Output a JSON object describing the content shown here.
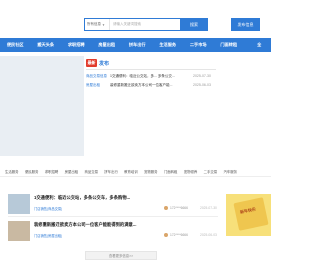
{
  "search": {
    "select_label": "所有信息",
    "placeholder": "请输入关键词搜索",
    "button_label": "搜索",
    "publish_label": "发布信息"
  },
  "nav": {
    "items": [
      "便民社区",
      "搬天头条",
      "求职招聘",
      "房屋出租",
      "拼车出行",
      "生活服务",
      "二手市场",
      "门面转租",
      "全"
    ]
  },
  "notice": {
    "badge": "最新",
    "title": "发布",
    "rows": [
      {
        "tag": "商品交易信息",
        "text": "1交通便利：临近公交站，多... 多条公交...",
        "date": "2025-07-30"
      },
      {
        "tag": "房屋出租",
        "text": "装修重新搬迁欲卖方本公司一位客户能...",
        "date": "2025-06-03"
      }
    ]
  },
  "categories": [
    "生活服务",
    "便民服务",
    "求职招聘",
    "房屋出租",
    "商品交易",
    "拼车出行",
    "教育培训",
    "宠物服务",
    "门面转租",
    "宠物领养",
    "二手交易",
    "汽车服务"
  ],
  "listings": [
    {
      "title": "1交通便利：临近公交站，多条公交车，多条购物...",
      "category": "门店销售|商品交易|",
      "user": "172****6666",
      "date": "2025-07-30"
    },
    {
      "title": "装修重新搬迁欲卖方本公司一位客户能能得到的满意...",
      "category": "门店销售|房屋出租|",
      "user": "172****6666",
      "date": "2025-06-03"
    }
  ],
  "side_ad": {
    "text": "新年快乐"
  },
  "more_button": "查看更多信息>>",
  "colors": {
    "primary": "#2f7bd6",
    "badge": "#e23c2c"
  }
}
